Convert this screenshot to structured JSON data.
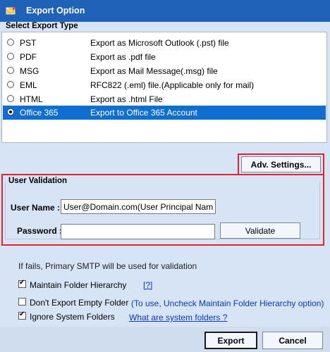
{
  "window": {
    "title": "Export Option"
  },
  "export_type": {
    "header": "Select Export Type",
    "options": [
      {
        "type": "PST",
        "description": "Export as Microsoft Outlook (.pst) file",
        "selected": false
      },
      {
        "type": "PDF",
        "description": "Export as .pdf file",
        "selected": false
      },
      {
        "type": "MSG",
        "description": "Export as Mail Message(.msg) file",
        "selected": false
      },
      {
        "type": "EML",
        "description": "RFC822 (.eml) file.(Applicable only for mail)",
        "selected": false
      },
      {
        "type": "HTML",
        "description": "Export as .html File",
        "selected": false
      },
      {
        "type": "Office 365",
        "description": "Export to Office 365 Account",
        "selected": true
      }
    ]
  },
  "adv_settings_label": "Adv. Settings...",
  "validation": {
    "title": "User Validation",
    "username_label": "User Name :",
    "username_value": "User@Domain.com(User Principal Name)",
    "password_label": "Password :",
    "password_value": "",
    "validate_label": "Validate"
  },
  "smtp_note": "If fails, Primary SMTP will be used for validation",
  "options": {
    "maintain_hierarchy": {
      "label": "Maintain Folder Hierarchy",
      "checked": true,
      "help_link": "[?]"
    },
    "dont_export_empty": {
      "label": "Don't Export Empty Folder",
      "checked": false,
      "hint": "(To use, Uncheck Maintain Folder Hierarchy option)"
    },
    "ignore_system": {
      "label": "Ignore System Folders",
      "checked": true,
      "link": "What are system folders ?"
    }
  },
  "footer": {
    "export_label": "Export",
    "cancel_label": "Cancel"
  },
  "colors": {
    "titlebar": "#1f62b8",
    "selection": "#0f6ecf",
    "highlight_box": "#e0232c",
    "link": "#0b37c8"
  }
}
